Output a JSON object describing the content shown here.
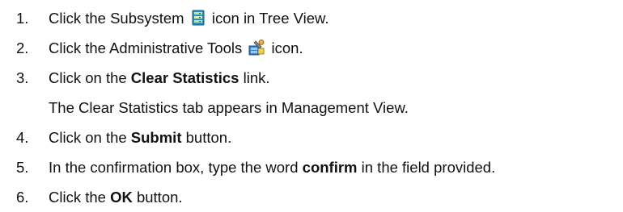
{
  "steps": [
    {
      "num": "1.",
      "a": "Click the Subsystem ",
      "b": " icon in Tree View.",
      "icon": "subsystem-icon"
    },
    {
      "num": "2.",
      "a": "Click the Administrative Tools ",
      "b": " icon.",
      "icon": "administrative-tools-icon"
    },
    {
      "num": "3.",
      "a": "Click on the ",
      "bold": "Clear Statistics",
      "b": " link."
    },
    {
      "note": "The Clear Statistics tab appears in Management View."
    },
    {
      "num": "4.",
      "a": "Click on the ",
      "bold": "Submit",
      "b": " button."
    },
    {
      "num": "5.",
      "a": "In the confirmation box, type the word ",
      "bold": "confirm",
      "b": " in the field provided."
    },
    {
      "num": "6.",
      "a": "Click the ",
      "bold": "OK",
      "b": " button."
    }
  ]
}
